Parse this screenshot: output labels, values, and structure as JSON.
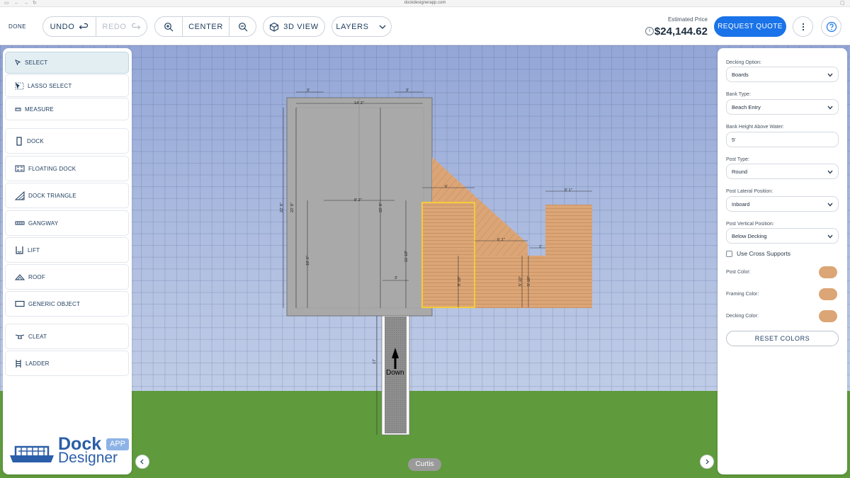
{
  "browser": {
    "url": "dockdesignerapp.com"
  },
  "toolbar": {
    "done_label": "DONE",
    "undo_label": "UNDO",
    "redo_label": "REDO",
    "center_label": "CENTER",
    "view3d_label": "3D VIEW",
    "layers_label": "LAYERS",
    "price_label": "Estimated Price",
    "price_value": "$24,144.62",
    "quote_label": "REQUEST QUOTE"
  },
  "tools": [
    {
      "label": "SELECT",
      "icon": "cursor-icon"
    },
    {
      "label": "LASSO SELECT",
      "icon": "lasso-icon"
    },
    {
      "label": "MEASURE",
      "icon": "ruler-icon"
    },
    {
      "label": "DOCK",
      "icon": "dock-icon"
    },
    {
      "label": "FLOATING DOCK",
      "icon": "floating-dock-icon"
    },
    {
      "label": "DOCK TRIANGLE",
      "icon": "triangle-icon"
    },
    {
      "label": "GANGWAY",
      "icon": "gangway-icon"
    },
    {
      "label": "LIFT",
      "icon": "lift-icon"
    },
    {
      "label": "ROOF",
      "icon": "roof-icon"
    },
    {
      "label": "GENERIC OBJECT",
      "icon": "rectangle-icon"
    },
    {
      "label": "CLEAT",
      "icon": "cleat-icon"
    },
    {
      "label": "LADDER",
      "icon": "ladder-icon"
    }
  ],
  "logo": {
    "line1": "Dock",
    "line2": "Designer",
    "badge": "APP"
  },
  "properties": {
    "decking_option": {
      "label": "Decking Option:",
      "value": "Boards"
    },
    "bank_type": {
      "label": "Bank Type:",
      "value": "Beach Entry"
    },
    "bank_height": {
      "label": "Bank Height Above Water:",
      "value": "5'"
    },
    "post_type": {
      "label": "Post Type:",
      "value": "Round"
    },
    "post_lateral": {
      "label": "Post Lateral Position:",
      "value": "Inboard"
    },
    "post_vertical": {
      "label": "Post Vertical Position:",
      "value": "Below Decking"
    },
    "cross_supports": {
      "label": "Use Cross Supports",
      "checked": false
    },
    "post_color": {
      "label": "Post Color:",
      "color": "#dca576"
    },
    "framing_color": {
      "label": "Framing Color:",
      "color": "#dca576"
    },
    "decking_color": {
      "label": "Decking Color:",
      "color": "#dca576"
    },
    "reset_label": "RESET COLORS"
  },
  "drawing": {
    "dims": {
      "top_left": "3'",
      "top_right": "3'",
      "width": "14' 2\"",
      "left_outer": "22' 8\"",
      "left_inner": "22' 8\"",
      "mid_width": "8' 2\"",
      "mid_height": "22' 8\"",
      "left_low": "10' 5\"",
      "right_low": "11' 10\"",
      "small": "3'",
      "orange_top": "6'",
      "orange_mid": "6' 1\"",
      "orange_h": "5' 10\"",
      "step_h1": "5' 10\"",
      "step_h2": "5' 10\"",
      "step_w": "1'",
      "right_top": "5' 1\"",
      "gangway_len": "17'"
    },
    "gangway_label": "Down",
    "name": "Curtis"
  },
  "colors": {
    "accent": "#1a73e8",
    "deck": "#dca576",
    "selection": "#f4c93e",
    "grass": "#5f9a3c"
  }
}
